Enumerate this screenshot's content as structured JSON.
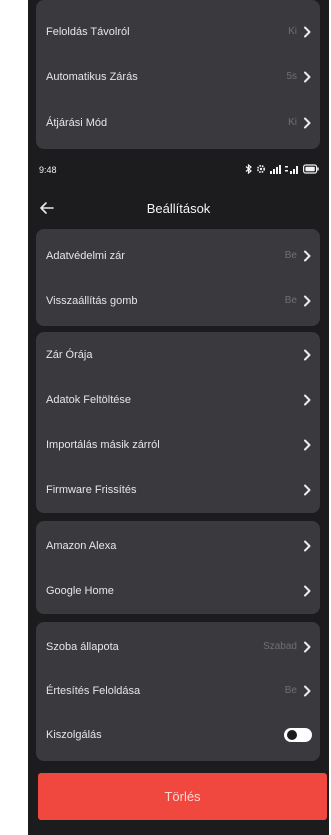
{
  "top_card": {
    "rows": [
      {
        "label": "Feloldás Távolról",
        "value": "Ki"
      },
      {
        "label": "Automatikus Zárás",
        "value": "5s"
      },
      {
        "label": "Átjárási Mód",
        "value": "Ki"
      }
    ]
  },
  "status_bar": {
    "time": "9:48",
    "icons": [
      "bluetooth-icon",
      "settings-icon",
      "wifi-icon",
      "signal-icon",
      "battery-icon"
    ]
  },
  "header": {
    "title": "Beállítások",
    "back_icon": "arrow-left-icon"
  },
  "card_privacy": {
    "rows": [
      {
        "label": "Adatvédelmi zár",
        "value": "Be"
      },
      {
        "label": "Visszaállítás gomb",
        "value": "Be"
      }
    ]
  },
  "card_device": {
    "rows": [
      {
        "label": "Zár Órája"
      },
      {
        "label": "Adatok Feltöltése"
      },
      {
        "label": "Importálás másik zárról"
      },
      {
        "label": "Firmware Frissítés"
      }
    ]
  },
  "card_assistants": {
    "rows": [
      {
        "label": "Amazon Alexa"
      },
      {
        "label": "Google Home"
      }
    ]
  },
  "card_room": {
    "rows": [
      {
        "label": "Szoba állapota",
        "value": "Szabad"
      },
      {
        "label": "Értesítés Feloldása",
        "value": "Be"
      },
      {
        "label": "Kiszolgálás",
        "toggle": "off"
      }
    ]
  },
  "delete_button": {
    "label": "Törlés"
  },
  "colors": {
    "background": "#1c1c1e",
    "card": "#3a3a3e",
    "danger": "#f0483e",
    "muted_text": "#6f6f74"
  }
}
